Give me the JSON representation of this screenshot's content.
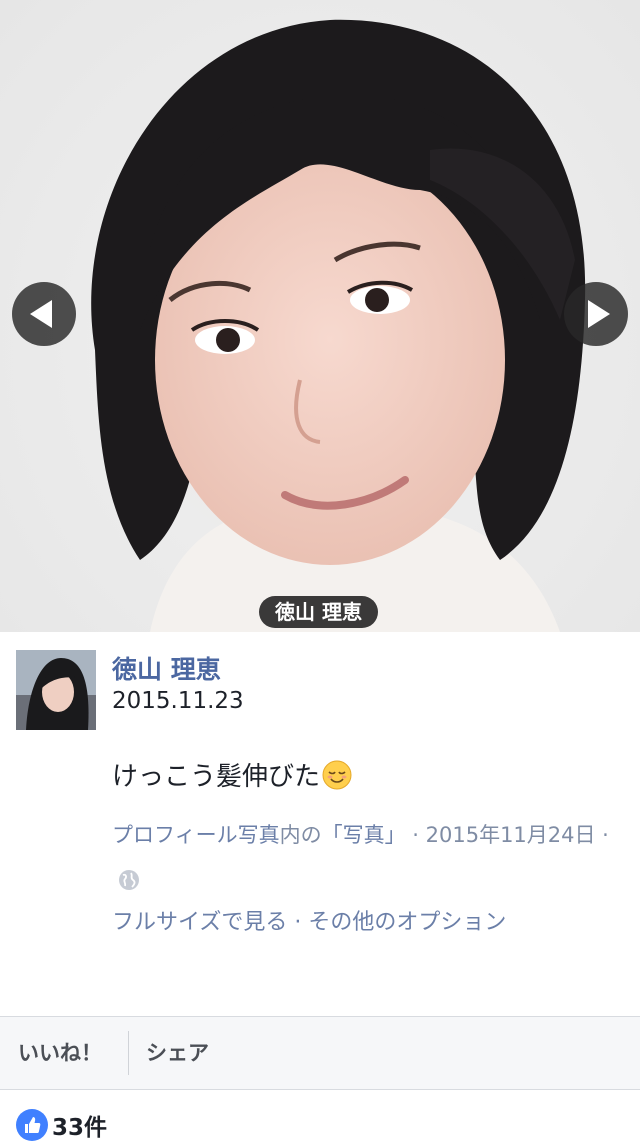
{
  "photo": {
    "prev_icon": "chevron-left-icon",
    "next_icon": "chevron-right-icon",
    "tag_name": "徳山 理恵"
  },
  "post": {
    "author": "徳山 理恵",
    "date": "2015.11.23",
    "caption": "けっこう髪伸びた",
    "caption_emoji": "relieved-face-emoji",
    "album_link": "プロフィール写真",
    "in_text": "内の",
    "photos_link": "「写真」",
    "timestamp": " · 2015年11月24日 · ",
    "privacy_icon": "globe-icon",
    "full_size_link": "フルサイズで見る",
    "separator": " · ",
    "more_options_link": "その他のオプション"
  },
  "actions": {
    "like_label": "いいね！",
    "share_label": "シェア"
  },
  "likes": {
    "icon": "thumbs-up-icon",
    "count": "33件"
  },
  "colors": {
    "link": "#4b67a1",
    "meta": "#7f8ca4",
    "action_bar": "#f6f7f9",
    "like_blue": "#4080ff"
  }
}
